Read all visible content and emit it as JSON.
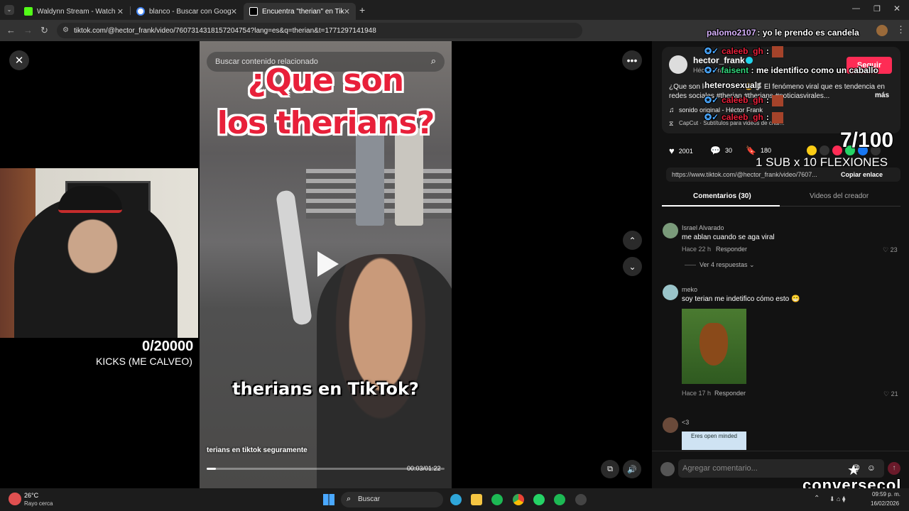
{
  "tabs": [
    {
      "title": "Waldynn Stream - Watch Live o",
      "color": "#53fc18",
      "active": false
    },
    {
      "title": "blanco - Buscar con Google",
      "color": "#4285f4",
      "active": false
    },
    {
      "title": "Encuentra \"therian\" en TikTok | É",
      "color": "#ffffff",
      "active": true
    }
  ],
  "address": {
    "url": "tiktok.com/@hector_frank/video/7607314318157204754?lang=es&q=therian&t=1771297141948"
  },
  "search": {
    "placeholder": "Buscar contenido relacionado"
  },
  "video": {
    "title_line1": "¿Que son",
    "title_line2": "los therians?",
    "subtitle": "therians en TikTok?",
    "caption": "terians en tiktok seguramente",
    "time": "00:03/01:22",
    "progress": 0.04
  },
  "stream_overlay": {
    "chat_top_user": "palomo2107",
    "chat_top_text": ": yo le prendo es candela",
    "chat_msgs": [
      {
        "user": "caleeb_gh",
        "text": ":"
      },
      {
        "user": "faisent",
        "text": ": me identifico como un caballo heterosexual"
      },
      {
        "user": "caleeb_gh",
        "text": ":"
      },
      {
        "user": "caleeb_gh",
        "text": ":"
      }
    ],
    "kicks_count": "0/20000",
    "kicks_label": "KICKS (ME CALVEO)",
    "sub_count": "7/100",
    "sub_label": "1 SUB x 10 FLEXIONES",
    "brand": "conversecol"
  },
  "creator": {
    "username": "hector_frank",
    "display": "Héctor Frank",
    "follow_label": "Seguir",
    "description": "¿Que son los therians? 😃🐺 El fenómeno viral que es tendencia en redes sociales #therian #therians #noticiasvirales...",
    "more": "más",
    "sound": "sonido original - Héctor Frank",
    "capcut": "CapCut · Subtítulos para videos de char..."
  },
  "stats": {
    "likes": "2001",
    "comments": "30",
    "saves": "180"
  },
  "share": {
    "url": "https://www.tiktok.com/@hector_frank/video/7607...",
    "copy_label": "Copiar enlace"
  },
  "panel_tabs": {
    "comments": "Comentarios (30)",
    "creator_videos": "Videos del creador"
  },
  "comments": [
    {
      "user": "Israel Alvarado",
      "text": "me ablan cuando se aga viral",
      "time": "Hace 22 h",
      "reply": "Responder",
      "likes": "23",
      "replies": "Ver 4 respuestas"
    },
    {
      "user": "meko",
      "text": "soy terian me indetifico cómo esto 😁",
      "time": "Hace 17 h",
      "reply": "Responder",
      "likes": "21"
    },
    {
      "user": "<3",
      "text": "",
      "sticker": "Eres open minded"
    }
  ],
  "comment_input": {
    "placeholder": "Agregar comentario..."
  },
  "taskbar": {
    "weather_temp": "26°C",
    "weather_desc": "Rayo cerca",
    "search": "Buscar",
    "date": "16/02/2026",
    "time": "09:59 p. m."
  }
}
